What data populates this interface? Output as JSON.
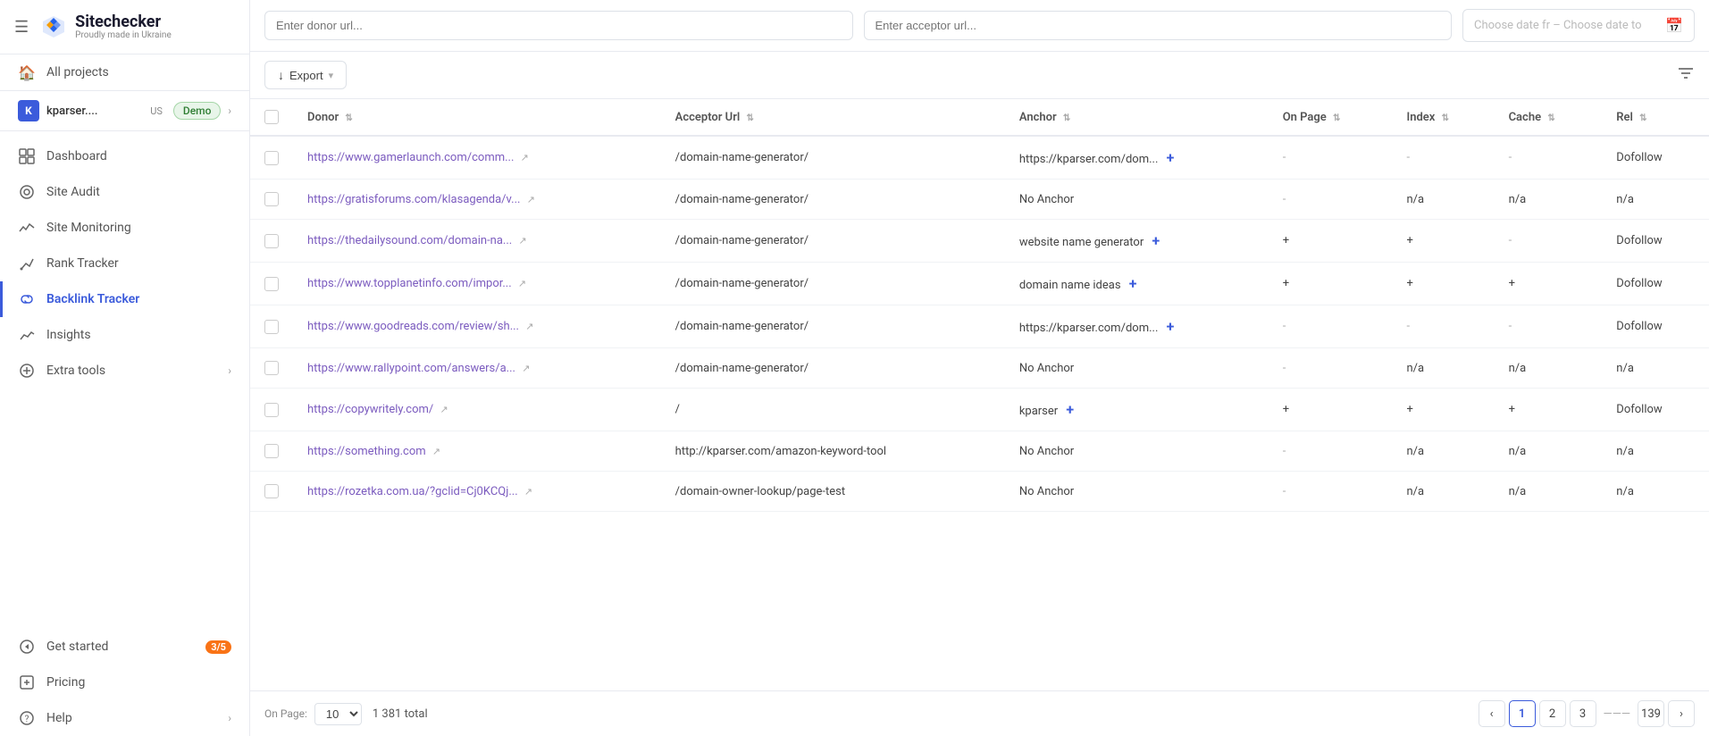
{
  "sidebar": {
    "logo": {
      "text": "Sitechecker",
      "subtitle": "Proudly made in Ukraine"
    },
    "hamburger": "☰",
    "project": {
      "name": "kparser....",
      "country": "US",
      "demo_label": "Demo"
    },
    "items": [
      {
        "id": "all-projects",
        "label": "All projects",
        "icon": "🏠",
        "active": false
      },
      {
        "id": "dashboard",
        "label": "Dashboard",
        "icon": "▦",
        "active": false
      },
      {
        "id": "site-audit",
        "label": "Site Audit",
        "icon": "◎",
        "active": false
      },
      {
        "id": "site-monitoring",
        "label": "Site Monitoring",
        "icon": "📡",
        "active": false
      },
      {
        "id": "rank-tracker",
        "label": "Rank Tracker",
        "icon": "✏️",
        "active": false
      },
      {
        "id": "backlink-tracker",
        "label": "Backlink Tracker",
        "icon": "🔗",
        "active": true
      },
      {
        "id": "insights",
        "label": "Insights",
        "icon": "✏️",
        "active": false
      },
      {
        "id": "extra-tools",
        "label": "Extra tools",
        "icon": "⊕",
        "active": false,
        "hasChevron": true
      },
      {
        "id": "get-started",
        "label": "Get started",
        "icon": "◇",
        "active": false,
        "badge": "3/5"
      },
      {
        "id": "pricing",
        "label": "Pricing",
        "icon": "◻",
        "active": false
      },
      {
        "id": "help",
        "label": "Help",
        "icon": "?",
        "active": false,
        "hasChevron": true
      }
    ]
  },
  "topbar": {
    "donor_placeholder": "Enter donor url...",
    "acceptor_placeholder": "Enter acceptor url...",
    "date_placeholder": "Choose date fr – Choose date to"
  },
  "toolbar": {
    "export_label": "Export",
    "export_icon": "↓"
  },
  "table": {
    "columns": [
      {
        "id": "donor",
        "label": "Donor"
      },
      {
        "id": "acceptor_url",
        "label": "Acceptor Url"
      },
      {
        "id": "anchor",
        "label": "Anchor"
      },
      {
        "id": "on_page",
        "label": "On Page"
      },
      {
        "id": "index",
        "label": "Index"
      },
      {
        "id": "cache",
        "label": "Cache"
      },
      {
        "id": "rel",
        "label": "Rel"
      }
    ],
    "rows": [
      {
        "donor": "https://www.gamerlaunch.com/comm...",
        "acceptor_url": "/domain-name-generator/",
        "anchor": "https://kparser.com/dom...",
        "anchor_plus": true,
        "on_page": "-",
        "index": "-",
        "cache": "-",
        "rel": "Dofollow"
      },
      {
        "donor": "https://gratisforums.com/klasagenda/v...",
        "acceptor_url": "/domain-name-generator/",
        "anchor": "No Anchor",
        "anchor_plus": false,
        "on_page": "-",
        "index": "n/a",
        "cache": "n/a",
        "rel": "n/a"
      },
      {
        "donor": "https://thedailysound.com/domain-na...",
        "acceptor_url": "/domain-name-generator/",
        "anchor": "website name generator",
        "anchor_plus": true,
        "on_page": "+",
        "index": "+",
        "cache": "-",
        "rel": "Dofollow"
      },
      {
        "donor": "https://www.topplanetinfo.com/impor...",
        "acceptor_url": "/domain-name-generator/",
        "anchor": "domain name ideas",
        "anchor_plus": true,
        "on_page": "+",
        "index": "+",
        "cache": "+",
        "rel": "Dofollow"
      },
      {
        "donor": "https://www.goodreads.com/review/sh...",
        "acceptor_url": "/domain-name-generator/",
        "anchor": "https://kparser.com/dom...",
        "anchor_plus": true,
        "on_page": "-",
        "index": "-",
        "cache": "-",
        "rel": "Dofollow"
      },
      {
        "donor": "https://www.rallypoint.com/answers/a...",
        "acceptor_url": "/domain-name-generator/",
        "anchor": "No Anchor",
        "anchor_plus": false,
        "on_page": "-",
        "index": "n/a",
        "cache": "n/a",
        "rel": "n/a"
      },
      {
        "donor": "https://copywritely.com/",
        "acceptor_url": "/",
        "anchor": "kparser",
        "anchor_plus": true,
        "on_page": "+",
        "index": "+",
        "cache": "+",
        "rel": "Dofollow"
      },
      {
        "donor": "https://something.com",
        "acceptor_url": "http://kparser.com/amazon-keyword-tool",
        "anchor": "No Anchor",
        "anchor_plus": false,
        "on_page": "-",
        "index": "n/a",
        "cache": "n/a",
        "rel": "n/a"
      },
      {
        "donor": "https://rozetka.com.ua/?gclid=Cj0KCQj...",
        "acceptor_url": "/domain-owner-lookup/page-test",
        "anchor": "No Anchor",
        "anchor_plus": false,
        "on_page": "-",
        "index": "n/a",
        "cache": "n/a",
        "rel": "n/a"
      }
    ]
  },
  "pagination": {
    "on_page_label": "On Page:",
    "page_size": "10",
    "total": "1 381 total",
    "pages": [
      "1",
      "2",
      "3"
    ],
    "last_page": "139",
    "current_page": "1"
  }
}
